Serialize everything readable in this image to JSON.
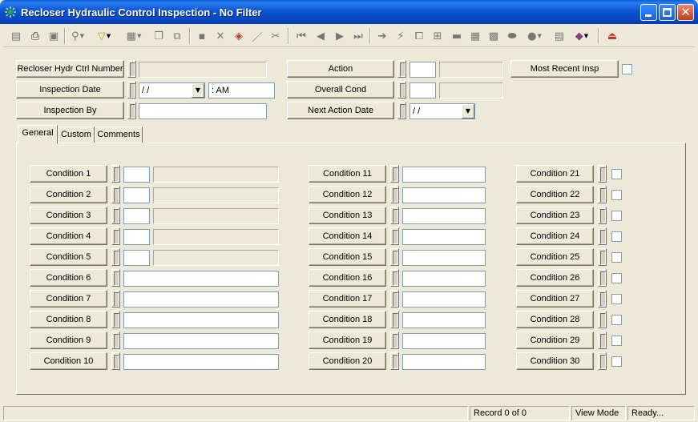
{
  "window": {
    "title": "Recloser Hydraulic Control Inspection - No Filter",
    "close_glyph": "✕"
  },
  "toolbar": {
    "icons": [
      "form-icon",
      "print-icon",
      "print-preview-icon",
      "find-icon",
      "filter-icon",
      "report-icon",
      "new-record-icon",
      "copy-record-icon",
      "save-icon",
      "delete-icon",
      "stack-icon",
      "edit-icon",
      "cut-icon",
      "first-record-icon",
      "prev-record-icon",
      "next-record-icon",
      "last-record-icon",
      "goto-icon",
      "lightning-icon",
      "link-icon",
      "tree-icon",
      "bar-icon",
      "grid-icon",
      "map-icon",
      "shape-icon",
      "globe-icon",
      "calculator-icon",
      "book-icon",
      "exit-icon"
    ]
  },
  "header": {
    "recloser_label": "Recloser Hydr Ctrl Number",
    "inspection_date_label": "Inspection Date",
    "inspection_date_value": " / /",
    "inspection_time_value": ":  AM",
    "inspection_by_label": "Inspection By",
    "action_label": "Action",
    "overall_cond_label": "Overall Cond",
    "next_action_date_label": "Next Action Date",
    "next_action_date_value": " / /",
    "most_recent_label": "Most Recent Insp"
  },
  "tabs": [
    "General",
    "Custom",
    "Comments"
  ],
  "conditions": {
    "col1": [
      "Condition 1",
      "Condition 2",
      "Condition 3",
      "Condition 4",
      "Condition 5",
      "Condition 6",
      "Condition 7",
      "Condition 8",
      "Condition 9",
      "Condition 10"
    ],
    "col2": [
      "Condition 11",
      "Condition 12",
      "Condition 13",
      "Condition 14",
      "Condition 15",
      "Condition 16",
      "Condition 17",
      "Condition 18",
      "Condition 19",
      "Condition 20"
    ],
    "col3": [
      "Condition 21",
      "Condition 22",
      "Condition 23",
      "Condition 24",
      "Condition 25",
      "Condition 26",
      "Condition 27",
      "Condition 28",
      "Condition 29",
      "Condition 30"
    ]
  },
  "status": {
    "record": "Record 0 of 0",
    "mode": "View Mode",
    "state": "Ready..."
  }
}
